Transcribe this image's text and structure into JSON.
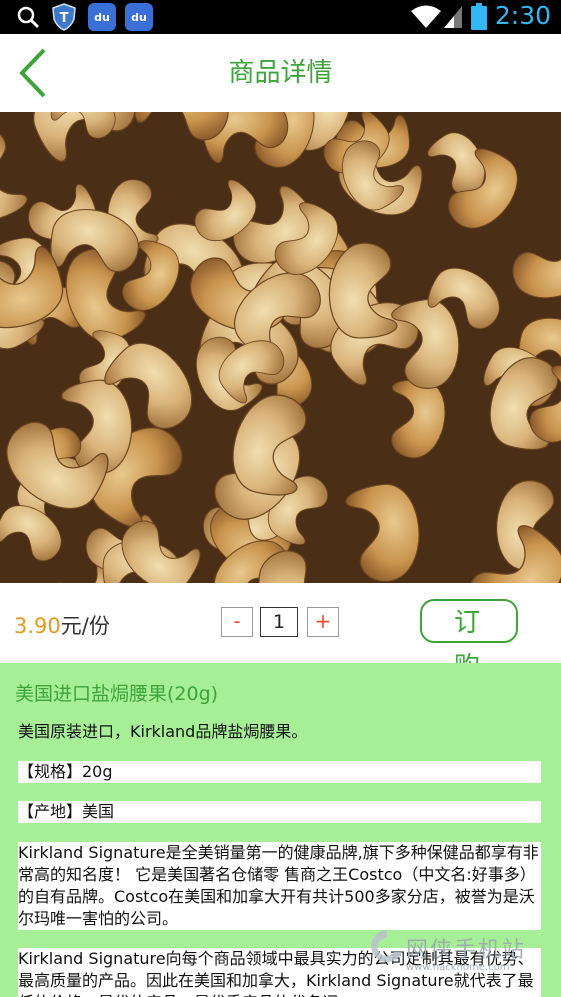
{
  "status_bar": {
    "time": "2:30",
    "app_icons": [
      "search-icon",
      "shield-app-icon",
      "baidu-app-icon",
      "baidu-app-icon"
    ],
    "app_labels": [
      "du",
      "du"
    ]
  },
  "header": {
    "title": "商品详情",
    "back_icon": "chevron-left-icon",
    "accent": "#3ea43a"
  },
  "product_bar": {
    "price": "3.90",
    "price_unit": "元/份",
    "minus_label": "-",
    "quantity": "1",
    "plus_label": "+",
    "order_label": "订 购",
    "price_color": "#e59a1d"
  },
  "detail": {
    "title": "美国进口盐焗腰果(20g)",
    "intro": "美国原装进口，Kirkland品牌盐焗腰果。",
    "spec": "【规格】20g",
    "origin": "【产地】美国",
    "para1": "Kirkland Signature是全美销量第一的健康品牌,旗下多种保健品都享有非常高的知名度！ 它是美国著名仓储零 售商之王Costco（中文名:好事多）的自有品牌。Costco在美国和加拿大开有共计500多家分店，被誉为是沃尔玛唯一害怕的公司。",
    "para2": " Kirkland Signature向每个商品领域中最具实力的公司定制其最有优势、最高质量的产品。因此在美国和加拿大，Kirkland Signature就代表了最低的价格、最优的产品，是优秀产品的代名词。",
    "background": "#a6ef96"
  },
  "watermark": {
    "text": "网侠手机站",
    "url": "www.hackhome.com"
  }
}
